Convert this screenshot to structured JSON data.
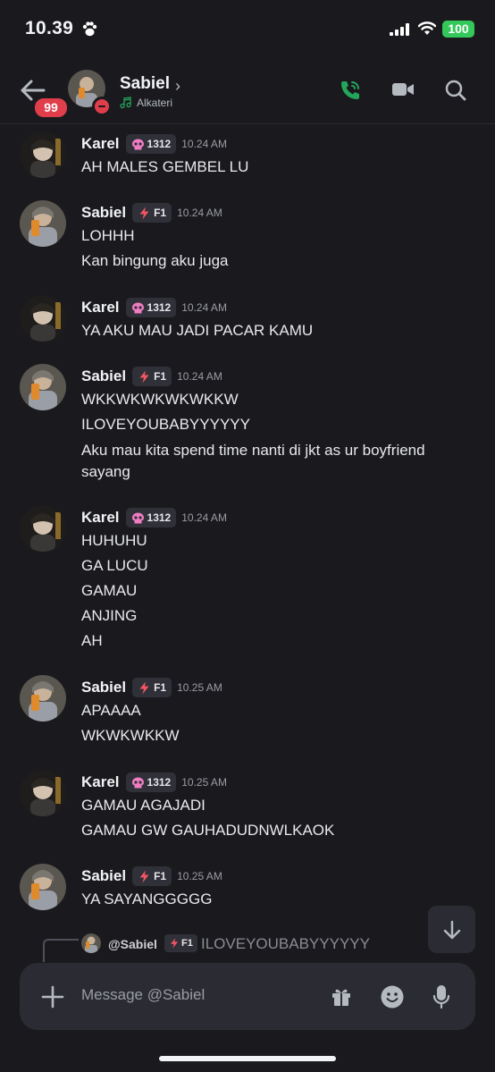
{
  "status_bar": {
    "time": "10.39",
    "battery": "100"
  },
  "header": {
    "unread_badge": "99",
    "name": "Sabiel",
    "activity": "Alkateri",
    "colors": {
      "accent_call": "#23a55a",
      "badge": "#e03e4b"
    }
  },
  "messages": [
    {
      "author": "Karel",
      "tag_icon": "skull-icon",
      "tag": "1312",
      "time": "10.24 AM",
      "lines": [
        "AH MALES GEMBEL LU"
      ]
    },
    {
      "author": "Sabiel",
      "tag_icon": "lightning-icon",
      "tag": "F1",
      "time": "10.24 AM",
      "lines": [
        "LOHHH",
        "Kan bingung aku juga"
      ]
    },
    {
      "author": "Karel",
      "tag_icon": "skull-icon",
      "tag": "1312",
      "time": "10.24 AM",
      "lines": [
        "YA AKU MAU JADI PACAR KAMU"
      ]
    },
    {
      "author": "Sabiel",
      "tag_icon": "lightning-icon",
      "tag": "F1",
      "time": "10.24 AM",
      "lines": [
        "WKKWKWKWKWKKW",
        "ILOVEYOUBABYYYYYY",
        "Aku mau kita spend time nanti di jkt as ur boyfriend sayang"
      ]
    },
    {
      "author": "Karel",
      "tag_icon": "skull-icon",
      "tag": "1312",
      "time": "10.24 AM",
      "lines": [
        "HUHUHU",
        "GA LUCU",
        "GAMAU",
        "ANJING",
        "AH"
      ]
    },
    {
      "author": "Sabiel",
      "tag_icon": "lightning-icon",
      "tag": "F1",
      "time": "10.25 AM",
      "lines": [
        "APAAAA",
        "WKWKWKKW"
      ]
    },
    {
      "author": "Karel",
      "tag_icon": "skull-icon",
      "tag": "1312",
      "time": "10.25 AM",
      "lines": [
        "GAMAU AGAJADI",
        "GAMAU GW GAUHADUDNWLKAOK"
      ]
    },
    {
      "author": "Sabiel",
      "tag_icon": "lightning-icon",
      "tag": "F1",
      "time": "10.25 AM",
      "lines": [
        "YA SAYANGGGGG"
      ]
    }
  ],
  "reply_preview": {
    "name": "@Sabiel",
    "tag": "F1",
    "text": "ILOVEYOUBABYYYYYY"
  },
  "composer": {
    "placeholder": "Message @Sabiel"
  }
}
